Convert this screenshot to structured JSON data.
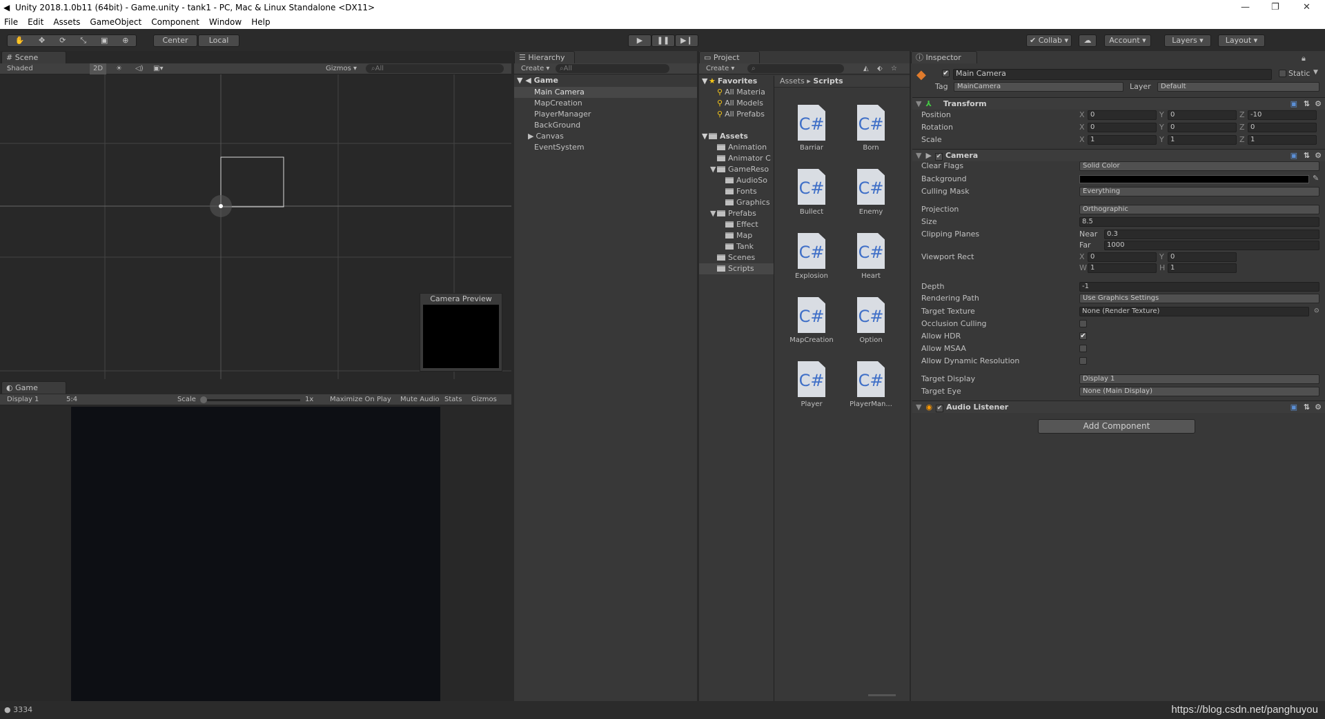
{
  "window": {
    "title": "Unity 2018.1.0b11 (64bit) - Game.unity - tank1 - PC, Mac & Linux Standalone <DX11>"
  },
  "menu": [
    "File",
    "Edit",
    "Assets",
    "GameObject",
    "Component",
    "Window",
    "Help"
  ],
  "toolbar": {
    "center": "Center",
    "local": "Local",
    "collab": "Collab",
    "account": "Account",
    "layers": "Layers",
    "layout": "Layout"
  },
  "scene": {
    "tab": "Scene",
    "shading": "Shaded",
    "mode2d": "2D",
    "gizmos": "Gizmos",
    "search": "All",
    "camera_preview": "Camera Preview"
  },
  "game": {
    "tab": "Game",
    "display": "Display 1",
    "aspect": "5:4",
    "scale_label": "Scale",
    "scale_value": "1x",
    "maximize": "Maximize On Play",
    "mute": "Mute Audio",
    "stats": "Stats",
    "gizmos": "Gizmos"
  },
  "hierarchy": {
    "tab": "Hierarchy",
    "create": "Create",
    "search": "All",
    "scene": "Game",
    "items": [
      {
        "label": "Main Camera",
        "selected": true
      },
      {
        "label": "MapCreation"
      },
      {
        "label": "PlayerManager"
      },
      {
        "label": "BackGround"
      },
      {
        "label": "Canvas",
        "expandable": true
      },
      {
        "label": "EventSystem"
      }
    ]
  },
  "project": {
    "tab": "Project",
    "create": "Create",
    "breadcrumb": [
      "Assets",
      "Scripts"
    ],
    "tree": [
      {
        "label": "Favorites",
        "level": 0,
        "type": "star",
        "bold": true
      },
      {
        "label": "All Materia",
        "level": 1,
        "type": "search"
      },
      {
        "label": "All Models",
        "level": 1,
        "type": "search"
      },
      {
        "label": "All Prefabs",
        "level": 1,
        "type": "search"
      },
      {
        "label": "",
        "level": 1,
        "type": "gap"
      },
      {
        "label": "Assets",
        "level": 0,
        "type": "folder",
        "bold": true
      },
      {
        "label": "Animation",
        "level": 1,
        "type": "folder"
      },
      {
        "label": "Animator C",
        "level": 1,
        "type": "folder"
      },
      {
        "label": "GameReso",
        "level": 1,
        "type": "folder",
        "expanded": true
      },
      {
        "label": "AudioSo",
        "level": 2,
        "type": "folder"
      },
      {
        "label": "Fonts",
        "level": 2,
        "type": "folder"
      },
      {
        "label": "Graphics",
        "level": 2,
        "type": "folder"
      },
      {
        "label": "Prefabs",
        "level": 1,
        "type": "folder",
        "expanded": true
      },
      {
        "label": "Effect",
        "level": 2,
        "type": "folder"
      },
      {
        "label": "Map",
        "level": 2,
        "type": "folder"
      },
      {
        "label": "Tank",
        "level": 2,
        "type": "folder"
      },
      {
        "label": "Scenes",
        "level": 1,
        "type": "folder"
      },
      {
        "label": "Scripts",
        "level": 1,
        "type": "folder",
        "selected": true
      }
    ],
    "assets": [
      "Barriar",
      "Born",
      "Bullect",
      "Enemy",
      "Explosion",
      "Heart",
      "MapCreation",
      "Option",
      "Player",
      "PlayerMan..."
    ],
    "asset_icon": "C#"
  },
  "inspector": {
    "tab": "Inspector",
    "object_name": "Main Camera",
    "static": "Static",
    "tag_label": "Tag",
    "tag": "MainCamera",
    "layer_label": "Layer",
    "layer": "Default",
    "transform": {
      "title": "Transform",
      "rows": [
        {
          "label": "Position",
          "x": "0",
          "y": "0",
          "z": "-10"
        },
        {
          "label": "Rotation",
          "x": "0",
          "y": "0",
          "z": "0"
        },
        {
          "label": "Scale",
          "x": "1",
          "y": "1",
          "z": "1"
        }
      ]
    },
    "camera": {
      "title": "Camera",
      "clear_flags_label": "Clear Flags",
      "clear_flags": "Solid Color",
      "background_label": "Background",
      "background_color": "#000000",
      "culling_label": "Culling Mask",
      "culling": "Everything",
      "projection_label": "Projection",
      "projection": "Orthographic",
      "size_label": "Size",
      "size": "8.5",
      "clipping_label": "Clipping Planes",
      "near_label": "Near",
      "near": "0.3",
      "far_label": "Far",
      "far": "1000",
      "viewport_label": "Viewport Rect",
      "vx": "0",
      "vy": "0",
      "vw": "1",
      "vh": "1",
      "depth_label": "Depth",
      "depth": "-1",
      "rendering_label": "Rendering Path",
      "rendering": "Use Graphics Settings",
      "target_texture_label": "Target Texture",
      "target_texture": "None (Render Texture)",
      "toggles": [
        {
          "label": "Occlusion Culling",
          "checked": false
        },
        {
          "label": "Allow HDR",
          "checked": true
        },
        {
          "label": "Allow MSAA",
          "checked": false
        },
        {
          "label": "Allow Dynamic Resolution",
          "checked": false
        }
      ],
      "target_display_label": "Target Display",
      "target_display": "Display 1",
      "target_eye_label": "Target Eye",
      "target_eye": "None (Main Display)"
    },
    "audio_listener": {
      "title": "Audio Listener"
    },
    "add_component": "Add Component"
  },
  "status": {
    "count": "3334"
  },
  "watermark": "https://blog.csdn.net/panghuyou"
}
